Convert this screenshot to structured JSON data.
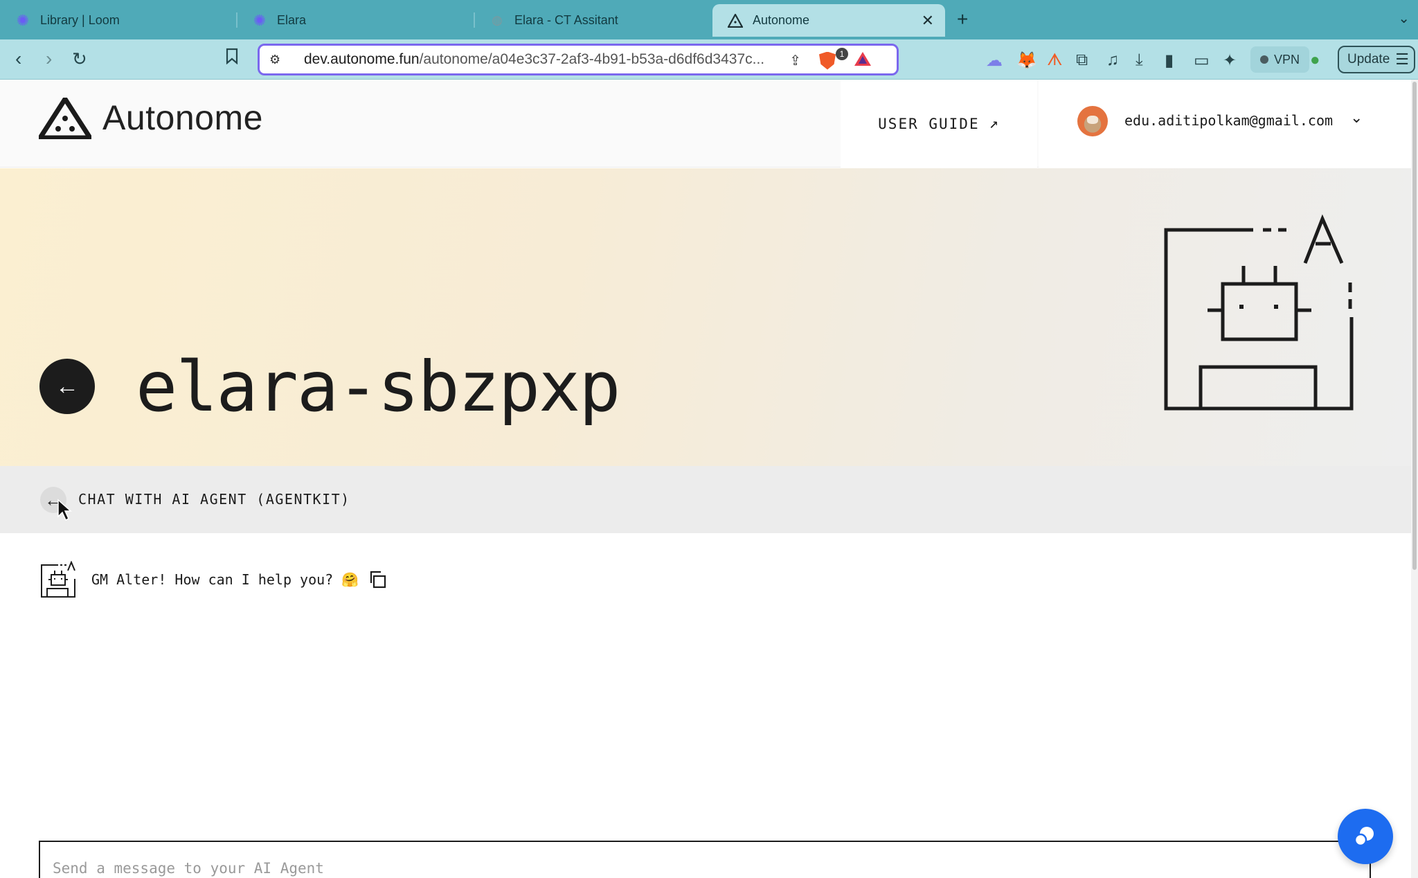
{
  "browser": {
    "tabs": [
      {
        "label": "Library | Loom",
        "icon": "loom-icon",
        "active": false
      },
      {
        "label": "Elara",
        "icon": "loom-icon",
        "active": false
      },
      {
        "label": "Elara - CT Assitant",
        "icon": "globe-icon",
        "active": false
      },
      {
        "label": "Autonome",
        "icon": "autonome-icon",
        "active": true
      }
    ],
    "url_host": "dev.autonome.fun",
    "url_path": "/autonome/a04e3c37-2af3-4b91-b53a-d6df6d3437c...",
    "brave_badge": "1",
    "vpn_label": "VPN",
    "update_label": "Update"
  },
  "header": {
    "brand": "Autonome",
    "user_guide_label": "USER GUIDE",
    "user_guide_icon": "arrow-up-right-icon",
    "email": "edu.aditipolkam@gmail.com"
  },
  "hero": {
    "agent_name": "elara-sbzpxp"
  },
  "section": {
    "title": "CHAT WITH AI AGENT (AGENTKIT)"
  },
  "chat": {
    "messages": [
      {
        "text": "GM Alter! How can I help you? 🤗"
      }
    ],
    "composer_placeholder": "Send a message to your AI Agent"
  },
  "colors": {
    "tab_bar": "#4faab8",
    "toolbar": "#b3e0e6",
    "omnibox_border": "#7b68ee",
    "hero_warm": "#fbefd1",
    "fab": "#1d6cf0"
  }
}
